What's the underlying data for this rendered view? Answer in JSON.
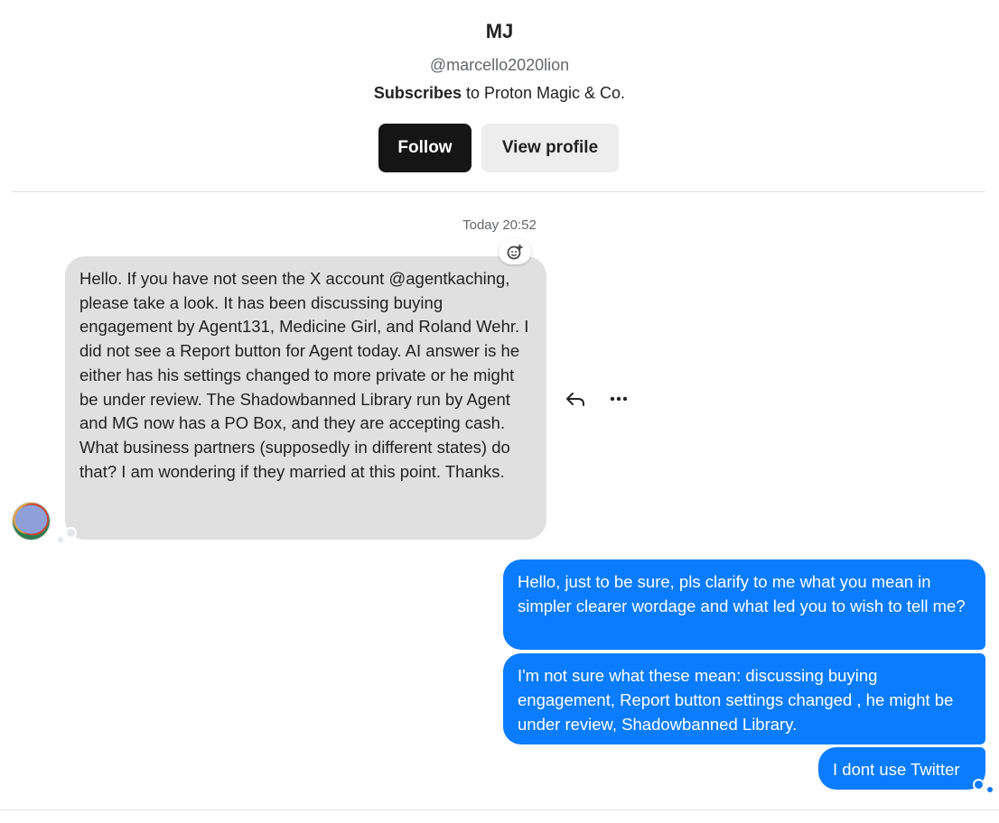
{
  "profile": {
    "name": "MJ",
    "handle": "@marcello2020lion",
    "subscribes_bold": "Subscribes",
    "subscribes_rest": " to Proton Magic & Co.",
    "follow_label": "Follow",
    "view_profile_label": "View profile"
  },
  "thread": {
    "timestamp": "Today 20:52",
    "incoming": {
      "text": "Hello. If you have not seen the X account @agentkaching, please take a look. It has been discussing buying engagement by Agent131, Medicine Girl, and Roland Wehr. I did not see a Report button for Agent today. AI answer is he either has his settings changed to more private or he might be under review. The Shadowbanned Library run by Agent and MG now has a PO Box, and they are accepting cash. What business partners (supposedly in different states) do that? I am wondering if they married at this point. Thanks."
    },
    "outgoing": [
      {
        "text": "Hello, just to be sure, pls clarify to me what you mean in simpler clearer wordage and what led you to wish to tell me?"
      },
      {
        "text": "I'm not sure what these mean: discussing buying engagement, Report button settings changed , he might be under review, Shadowbanned Library."
      },
      {
        "text": "I dont use Twitter"
      }
    ]
  },
  "icons": {
    "react": "add-reaction-icon",
    "reply": "reply-icon",
    "more": "more-options-icon",
    "avatar": "user-avatar"
  },
  "colors": {
    "outgoing_bubble": "#0a7cff",
    "incoming_bubble": "#e0e0e0",
    "follow_button": "#151515"
  }
}
